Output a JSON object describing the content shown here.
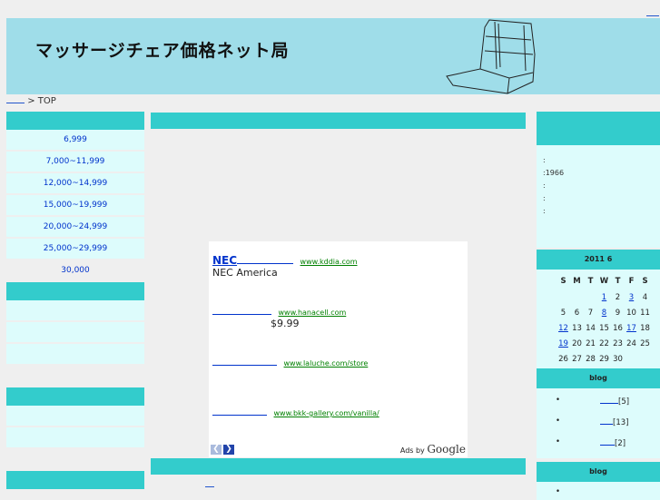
{
  "header": {
    "site_title": "マッサージチェア価格ネット局"
  },
  "breadcrumb": {
    "separator": "> TOP"
  },
  "left_menu": {
    "items": [
      "6,999",
      "7,000~11,999",
      "12,000~14,999",
      "15,000~19,999",
      "20,000~24,999",
      "25,000~29,999",
      "30,000"
    ]
  },
  "ads": {
    "items": [
      {
        "title": "NEC",
        "url": "www.kddia.com",
        "desc": "NEC America"
      },
      {
        "title": "",
        "url": "www.hanacell.com",
        "desc": "$9.99"
      },
      {
        "title": "",
        "url": "www.laluche.com/store",
        "desc": ""
      },
      {
        "title": "",
        "url": "www.bkk-gallery.com/vanilla/",
        "desc": ""
      }
    ],
    "ads_by": "Ads by",
    "google": "Google"
  },
  "profile": {
    "lines": [
      ":",
      ":1966",
      ":",
      ":",
      ":"
    ]
  },
  "calendar": {
    "title": "2011 6",
    "weekdays": [
      "S",
      "M",
      "T",
      "W",
      "T",
      "F",
      "S"
    ],
    "weeks": [
      [
        "",
        "",
        "",
        "1",
        "2",
        "3",
        "4"
      ],
      [
        "5",
        "6",
        "7",
        "8",
        "9",
        "10",
        "11"
      ],
      [
        "12",
        "13",
        "14",
        "15",
        "16",
        "17",
        "18"
      ],
      [
        "19",
        "20",
        "21",
        "22",
        "23",
        "24",
        "25"
      ],
      [
        "26",
        "27",
        "28",
        "29",
        "30",
        "",
        ""
      ]
    ],
    "linked_days": [
      "1",
      "3",
      "8",
      "12",
      "17",
      "19"
    ]
  },
  "blog1": {
    "title": "blog",
    "items": [
      {
        "bullet": "•",
        "count": "[5]"
      },
      {
        "bullet": "•",
        "count": "[13]"
      },
      {
        "bullet": "•",
        "count": "[2]"
      }
    ]
  },
  "blog2": {
    "title": "blog",
    "items": [
      {
        "bullet": "•"
      }
    ]
  }
}
